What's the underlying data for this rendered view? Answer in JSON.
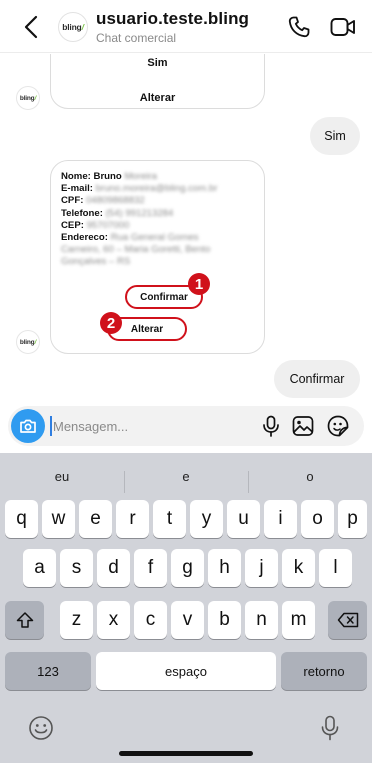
{
  "header": {
    "title": "usuario.teste.bling",
    "subtitle": "Chat comercial",
    "logo_text": "bling"
  },
  "messages": {
    "card1": {
      "option1": "Sim",
      "option2": "Alterar"
    },
    "reply1": "Sim",
    "card2": {
      "nome_label": "Nome: Bruno",
      "nome_value": "Moreira",
      "email_label": "E-mail:",
      "email_value": "bruno.moreira@bling.com.br",
      "cpf_label": "CPF:",
      "cpf_value": "04809868832",
      "telefone_label": "Telefone:",
      "telefone_value": "(54) 991213284",
      "cep_label": "CEP:",
      "cep_value": "95707000",
      "endereco_label": "Endereco:",
      "endereco_value_1": "Rua General Gomes",
      "endereco_value_2": "Carneiro, 60 – Maria Goretti, Bento",
      "endereco_value_3": "Gonçalves – RS",
      "confirm_label": "Confirmar",
      "alter_label": "Alterar",
      "marker1": "1",
      "marker2": "2"
    },
    "reply2": "Confirmar"
  },
  "composer": {
    "placeholder": "Mensagem..."
  },
  "keyboard": {
    "suggestions": [
      "eu",
      "e",
      "o"
    ],
    "row1": [
      "q",
      "w",
      "e",
      "r",
      "t",
      "y",
      "u",
      "i",
      "o",
      "p"
    ],
    "row2": [
      "a",
      "s",
      "d",
      "f",
      "g",
      "h",
      "j",
      "k",
      "l"
    ],
    "row3": [
      "z",
      "x",
      "c",
      "v",
      "b",
      "n",
      "m"
    ],
    "numbers_label": "123",
    "space_label": "espaço",
    "return_label": "retorno"
  },
  "colors": {
    "accent_red": "#d0111b",
    "camera_blue": "#2f9bf0",
    "bling_green": "#77c043"
  }
}
